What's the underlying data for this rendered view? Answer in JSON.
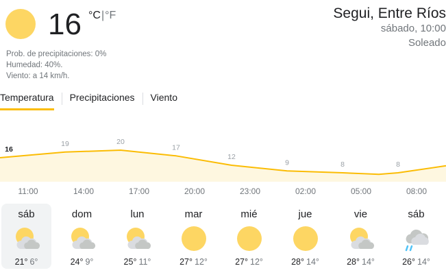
{
  "current": {
    "temperature": "16",
    "unit_c": "°C",
    "unit_f": "°F",
    "precipitation": "Prob. de precipitaciones: 0%",
    "humidity": "Humedad: 40%.",
    "wind": "Viento: a 14 km/h.",
    "icon": "sun-icon",
    "sun_color": "#fdd663"
  },
  "location": {
    "name": "Segui, Entre Ríos",
    "day_time": "sábado, 10:00",
    "condition": "Soleado"
  },
  "tabs": [
    "Temperatura",
    "Precipitaciones",
    "Viento"
  ],
  "accent_color": "#fbbc04",
  "chart_data": {
    "type": "area",
    "x": [
      "11:00",
      "14:00",
      "17:00",
      "20:00",
      "23:00",
      "02:00",
      "05:00",
      "08:00"
    ],
    "values": [
      16,
      19,
      20,
      17,
      12,
      9,
      8,
      8
    ],
    "labels": [
      "16",
      "19",
      "20",
      "17",
      "12",
      "9",
      "8",
      "8"
    ],
    "xlabel": "",
    "ylabel": "",
    "line_color": "#fbbc04",
    "fill_color": "#fef7e0"
  },
  "forecast": [
    {
      "day": "sáb",
      "high": "21°",
      "low": "6°",
      "icon": "partly-cloudy-icon"
    },
    {
      "day": "dom",
      "high": "24°",
      "low": "9°",
      "icon": "partly-cloudy-icon"
    },
    {
      "day": "lun",
      "high": "25°",
      "low": "11°",
      "icon": "partly-cloudy-icon"
    },
    {
      "day": "mar",
      "high": "27°",
      "low": "12°",
      "icon": "sun-icon"
    },
    {
      "day": "mié",
      "high": "27°",
      "low": "12°",
      "icon": "sun-icon"
    },
    {
      "day": "jue",
      "high": "28°",
      "low": "14°",
      "icon": "sun-icon"
    },
    {
      "day": "vie",
      "high": "28°",
      "low": "14°",
      "icon": "partly-cloudy-icon"
    },
    {
      "day": "sáb",
      "high": "26°",
      "low": "14°",
      "icon": "rain-showers-icon"
    }
  ]
}
